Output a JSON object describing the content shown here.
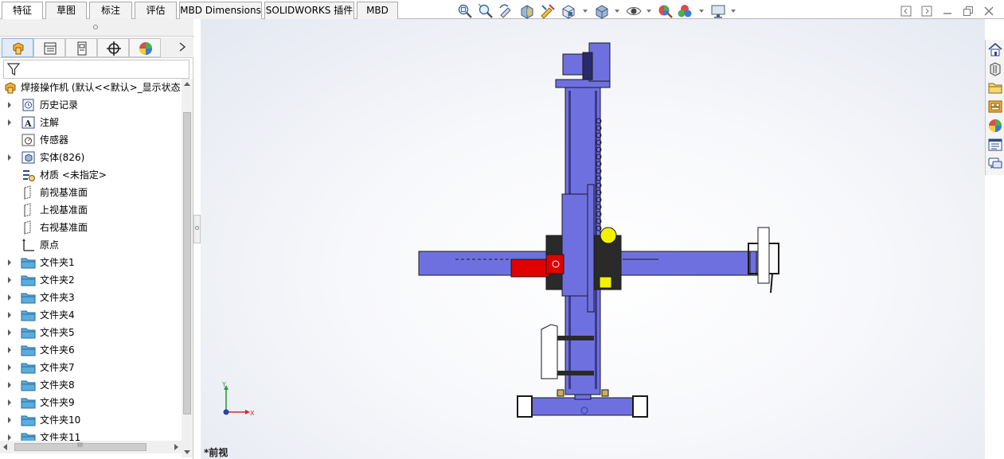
{
  "tabs": [
    {
      "label": "特征",
      "active": true
    },
    {
      "label": "草图",
      "active": false
    },
    {
      "label": "标注",
      "active": false
    },
    {
      "label": "评估",
      "active": false
    },
    {
      "label": "MBD Dimensions",
      "active": false
    },
    {
      "label": "SOLIDWORKS 插件",
      "active": false
    },
    {
      "label": "MBD",
      "active": false
    }
  ],
  "view_toolbar": {
    "icons": [
      "zoom-to-fit-icon",
      "zoom-to-area-icon",
      "previous-view-icon",
      "section-view-icon",
      "dynamic-annotation-icon",
      "view-orientation-icon",
      "display-style-icon",
      "hide-show-items-icon",
      "edit-appearance-icon",
      "apply-scene-icon",
      "view-settings-icon"
    ]
  },
  "panel_tabs": [
    "featuremanager-tab",
    "propertymanager-tab",
    "configurationmanager-tab",
    "dimxpertmanager-tab",
    "displaymanager-tab"
  ],
  "tree": {
    "root_label": "焊接操作机 (默认<<默认>_显示状态",
    "items": [
      {
        "label": "历史记录",
        "icon": "history-icon",
        "expandable": true
      },
      {
        "label": "注解",
        "icon": "annotations-icon",
        "expandable": true
      },
      {
        "label": "传感器",
        "icon": "sensors-icon",
        "expandable": false
      },
      {
        "label": "实体(826)",
        "icon": "solid-bodies-icon",
        "expandable": true
      },
      {
        "label": "材质 <未指定>",
        "icon": "material-icon",
        "expandable": false
      },
      {
        "label": "前视基准面",
        "icon": "plane-icon",
        "expandable": false
      },
      {
        "label": "上视基准面",
        "icon": "plane-icon",
        "expandable": false
      },
      {
        "label": "右视基准面",
        "icon": "plane-icon",
        "expandable": false
      },
      {
        "label": "原点",
        "icon": "origin-icon",
        "expandable": false
      },
      {
        "label": "文件夹1",
        "icon": "folder-icon",
        "expandable": true
      },
      {
        "label": "文件夹2",
        "icon": "folder-icon",
        "expandable": true
      },
      {
        "label": "文件夹3",
        "icon": "folder-icon",
        "expandable": true
      },
      {
        "label": "文件夹4",
        "icon": "folder-icon",
        "expandable": true
      },
      {
        "label": "文件夹5",
        "icon": "folder-icon",
        "expandable": true
      },
      {
        "label": "文件夹6",
        "icon": "folder-icon",
        "expandable": true
      },
      {
        "label": "文件夹7",
        "icon": "folder-icon",
        "expandable": true
      },
      {
        "label": "文件夹8",
        "icon": "folder-icon",
        "expandable": true
      },
      {
        "label": "文件夹9",
        "icon": "folder-icon",
        "expandable": true
      },
      {
        "label": "文件夹10",
        "icon": "folder-icon",
        "expandable": true
      },
      {
        "label": "文件夹11",
        "icon": "folder-icon",
        "expandable": true
      }
    ]
  },
  "hscroll_label": "III",
  "viewport": {
    "view_name": "*前视",
    "triad": {
      "x_label": "X",
      "y_label": "Y"
    },
    "colors": {
      "steel": "#6f70e0",
      "motor": "#e00000",
      "accent": "#f2f200",
      "dark": "#2a2a2a"
    }
  },
  "task_pane": [
    "home-icon",
    "design-library-icon",
    "file-explorer-icon",
    "view-palette-icon",
    "appearances-icon",
    "custom-properties-icon",
    "forum-icon"
  ],
  "window_controls": [
    "restore-pane-icon",
    "expand-pane-icon",
    "restore-icon",
    "close-icon"
  ]
}
